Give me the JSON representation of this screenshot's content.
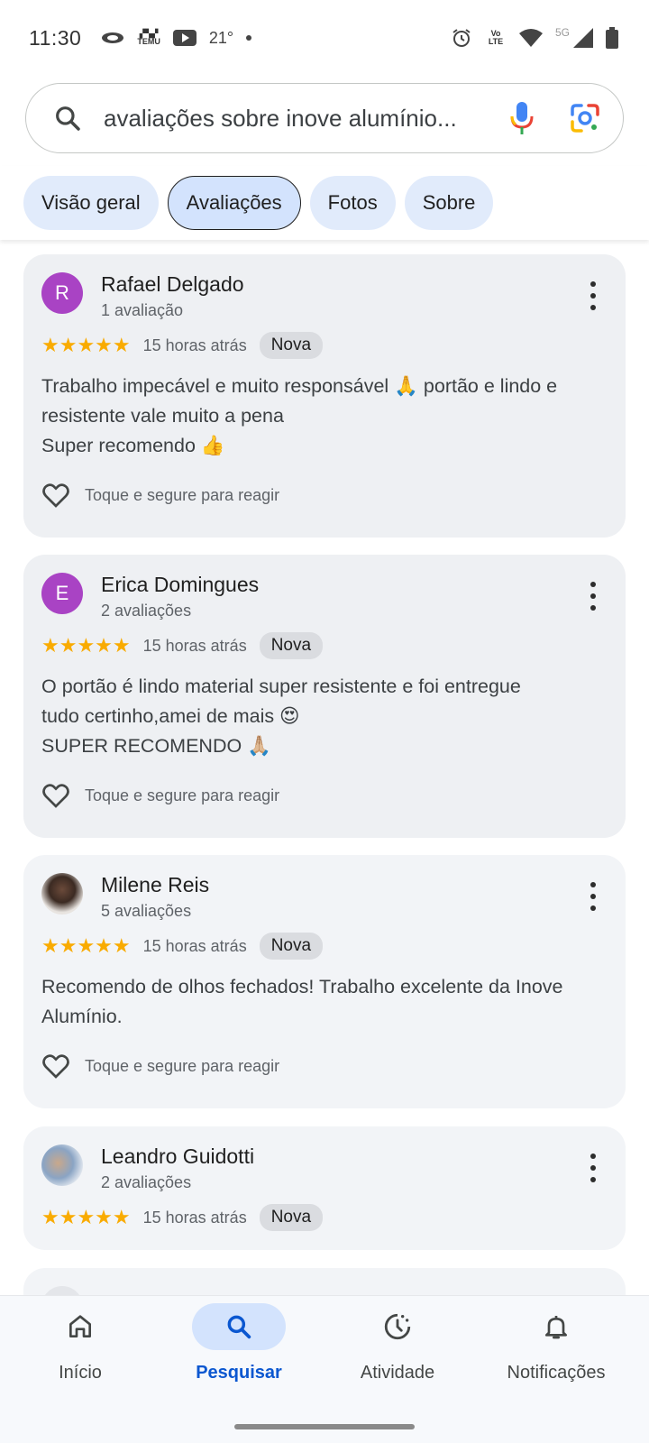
{
  "status_bar": {
    "time": "11:30",
    "temperature": "21°",
    "temu_label": "TEMU",
    "volte_label": "Vo LTE",
    "network_label": "5G"
  },
  "search": {
    "query": "avaliações sobre inove alumínio..."
  },
  "tabs": [
    {
      "label": "Visão geral",
      "active": false
    },
    {
      "label": "Avaliações",
      "active": true
    },
    {
      "label": "Fotos",
      "active": false
    },
    {
      "label": "Sobre",
      "active": false
    }
  ],
  "reviews": [
    {
      "avatar_letter": "R",
      "name": "Rafael Delgado",
      "count": "1 avaliação",
      "stars": 5,
      "time": "15 horas atrás",
      "badge": "Nova",
      "lines": [
        "Trabalho impecável e muito responsável 🙏 portão e lindo e",
        "resistente vale muito a pena",
        "Super recomendo 👍"
      ],
      "react": "Toque e segure para reagir"
    },
    {
      "avatar_letter": "E",
      "name": "Erica Domingues",
      "count": "2 avaliações",
      "stars": 5,
      "time": "15 horas atrás",
      "badge": "Nova",
      "lines": [
        "O portão é lindo material super resistente e foi entregue",
        "tudo certinho,amei de mais 😍",
        "SUPER RECOMENDO 🙏🏼"
      ],
      "react": "Toque e segure para reagir"
    },
    {
      "avatar_letter": "",
      "name": "Milene Reis",
      "count": "5 avaliações",
      "stars": 5,
      "time": "15 horas atrás",
      "badge": "Nova",
      "lines": [
        "Recomendo de olhos fechados! Trabalho excelente da Inove",
        "Alumínio."
      ],
      "react": "Toque e segure para reagir"
    },
    {
      "avatar_letter": "",
      "name": "Leandro Guidotti",
      "count": "2 avaliações",
      "stars": 5,
      "time": "15 horas atrás",
      "badge": "Nova"
    }
  ],
  "bottom_nav": [
    {
      "label": "Início",
      "icon": "home-icon",
      "active": false
    },
    {
      "label": "Pesquisar",
      "icon": "search-icon",
      "active": true
    },
    {
      "label": "Atividade",
      "icon": "activity-icon",
      "active": false
    },
    {
      "label": "Notificações",
      "icon": "bell-icon",
      "active": false
    }
  ],
  "colors": {
    "accent": "#0b57d0",
    "star": "#f9ab00",
    "avatar_letter_bg": "#a943c4",
    "chip_bg": "#d3e3fd"
  }
}
